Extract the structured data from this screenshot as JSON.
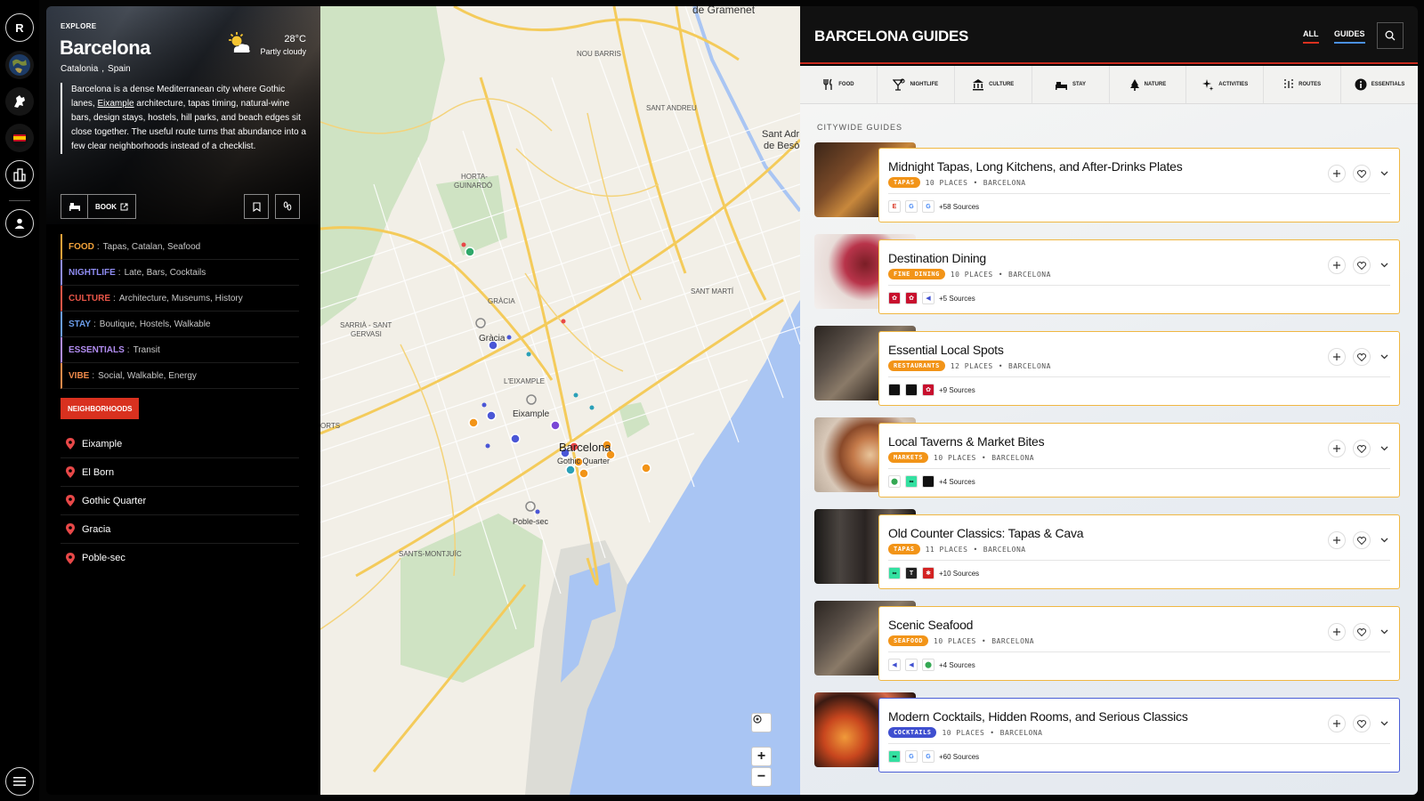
{
  "rail": {
    "avatar_letter": "R"
  },
  "explore": {
    "eyebrow": "EXPLORE",
    "city": "Barcelona",
    "region": "Catalonia",
    "region_sep": ",",
    "country": "Spain",
    "temperature": "28°C",
    "conditions": "Partly cloudy",
    "description_before": "Barcelona is a dense Mediterranean city where Gothic lanes, ",
    "description_link": "Eixample",
    "description_after": " architecture, tapas timing, natural-wine bars, design stays, hostels, hill parks, and beach edges sit close together. The useful route turns that abundance into a few clear neighborhoods instead of a checklist.",
    "book_label": "BOOK",
    "tags": [
      {
        "key": "FOOD",
        "sep": ":",
        "value": "Tapas, Catalan, Seafood",
        "color": "#f2a23a"
      },
      {
        "key": "NIGHTLIFE",
        "sep": ":",
        "value": "Late, Bars, Cocktails",
        "color": "#8f8cf2"
      },
      {
        "key": "CULTURE",
        "sep": ":",
        "value": "Architecture, Museums, History",
        "color": "#ea5648"
      },
      {
        "key": "STAY",
        "sep": ":",
        "value": "Boutique, Hostels, Walkable",
        "color": "#6b9dea"
      },
      {
        "key": "ESSENTIALS",
        "sep": ":",
        "value": "Transit",
        "color": "#b18cf0"
      },
      {
        "key": "VIBE",
        "sep": ":",
        "value": "Social, Walkable, Energy",
        "color": "#f08a4a"
      }
    ],
    "neighborhoods_label": "NEIGHBORHOODS",
    "neighborhoods": [
      "Eixample",
      "El Born",
      "Gothic Quarter",
      "Gracia",
      "Poble-sec"
    ]
  },
  "map": {
    "labels": {
      "gramenet": "de Gramenet",
      "nou_barris": "NOU BARRIS",
      "sant_andreu": "SANT ANDREU",
      "sant_adria": "Sant Adri",
      "de_besos": "de Besò",
      "horta": "HORTA-",
      "guinardo": "GUINARDÓ",
      "gracia_district": "GRÀCIA",
      "gracia": "Gràcia",
      "sant_marti": "SANT MARTÍ",
      "sarria": "SARRIÀ - SANT",
      "gervasi": "GERVASI",
      "eixample_district": "L'EIXAMPLE",
      "eixample": "Eixample",
      "barcelona": "Barcelona",
      "gothic": "Gothic Quarter",
      "poble_sec": "Poble-sec",
      "sants": "SANTS-MONTJUÏC",
      "orts": "ORTS"
    },
    "zoom_in": "+",
    "zoom_out": "−"
  },
  "guides": {
    "title": "BARCELONA GUIDES",
    "tabs": [
      "ALL",
      "GUIDES"
    ],
    "categories": [
      "FOOD",
      "NIGHTLIFE",
      "CULTURE",
      "STAY",
      "NATURE",
      "ACTIVITIES",
      "ROUTES",
      "ESSENTIALS"
    ],
    "section": "CITYWIDE GUIDES",
    "cards": [
      {
        "title": "Midnight Tapas, Long Kitchens, and After-Drinks Plates",
        "tag": "TAPAS",
        "places": "10 PLACES",
        "dot": "•",
        "city": "BARCELONA",
        "sources": "+58 Sources"
      },
      {
        "title": "Destination Dining",
        "tag": "FINE DINING",
        "places": "10 PLACES",
        "dot": "•",
        "city": "BARCELONA",
        "sources": "+5 Sources"
      },
      {
        "title": "Essential Local Spots",
        "tag": "RESTAURANTS",
        "places": "12 PLACES",
        "dot": "•",
        "city": "BARCELONA",
        "sources": "+9 Sources"
      },
      {
        "title": "Local Taverns & Market Bites",
        "tag": "MARKETS",
        "places": "10 PLACES",
        "dot": "•",
        "city": "BARCELONA",
        "sources": "+4 Sources"
      },
      {
        "title": "Old Counter Classics: Tapas & Cava",
        "tag": "TAPAS",
        "places": "11 PLACES",
        "dot": "•",
        "city": "BARCELONA",
        "sources": "+10 Sources"
      },
      {
        "title": "Scenic Seafood",
        "tag": "SEAFOOD",
        "places": "10 PLACES",
        "dot": "•",
        "city": "BARCELONA",
        "sources": "+4 Sources"
      },
      {
        "title": "Modern Cocktails, Hidden Rooms, and Serious Classics",
        "tag": "COCKTAILS",
        "places": "10 PLACES",
        "dot": "•",
        "city": "BARCELONA",
        "sources": "+60 Sources"
      }
    ]
  },
  "colors": {
    "accent_red": "#d9311f",
    "card_border": "#f0b742",
    "card_border_active": "#4a5ed6",
    "pill_orange": "#f29418",
    "pill_blue": "#3f4fd0",
    "tab_blue": "#4a90e2"
  }
}
